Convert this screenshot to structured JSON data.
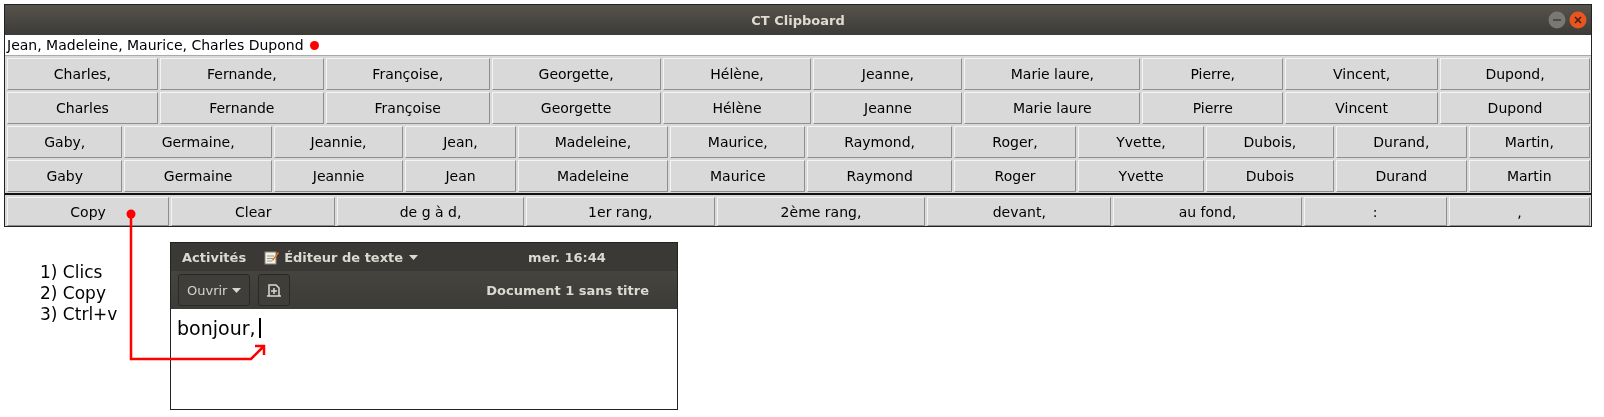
{
  "window": {
    "title": "CT Clipboard"
  },
  "clipboard_field": {
    "value": "Jean, Madeleine, Maurice, Charles Dupond"
  },
  "button_rows": [
    {
      "labels": [
        "Charles,",
        "Fernande,",
        "Françoise,",
        "Georgette,",
        "Hélène,",
        "Jeanne,",
        "Marie laure,",
        "Pierre,",
        "Vincent,",
        "Dupond,"
      ]
    },
    {
      "labels": [
        "Charles",
        "Fernande",
        "Françoise",
        "Georgette",
        "Hélène",
        "Jeanne",
        "Marie laure",
        "Pierre",
        "Vincent",
        "Dupond"
      ]
    },
    {
      "labels": [
        "Gaby,",
        "Germaine,",
        "Jeannie,",
        "Jean,",
        "Madeleine,",
        "Maurice,",
        "Raymond,",
        "Roger,",
        "Yvette,",
        "Dubois,",
        "Durand,",
        "Martin,"
      ]
    },
    {
      "labels": [
        "Gaby",
        "Germaine",
        "Jeannie",
        "Jean",
        "Madeleine",
        "Maurice",
        "Raymond",
        "Roger",
        "Yvette",
        "Dubois",
        "Durand",
        "Martin"
      ]
    }
  ],
  "toolbar": {
    "labels": [
      "Copy",
      "Clear",
      "de g à d,",
      "1er rang,",
      "2ème rang,",
      "devant,",
      "au fond,",
      ":",
      ","
    ]
  },
  "steps": [
    "1) Clics",
    "2) Copy",
    "3) Ctrl+v"
  ],
  "editor": {
    "activities": "Activités",
    "app_menu": "Éditeur de texte",
    "clock": "mer. 16:44",
    "open_button": "Ouvrir",
    "document_title": "Document 1 sans titre",
    "content": "bonjour,"
  }
}
